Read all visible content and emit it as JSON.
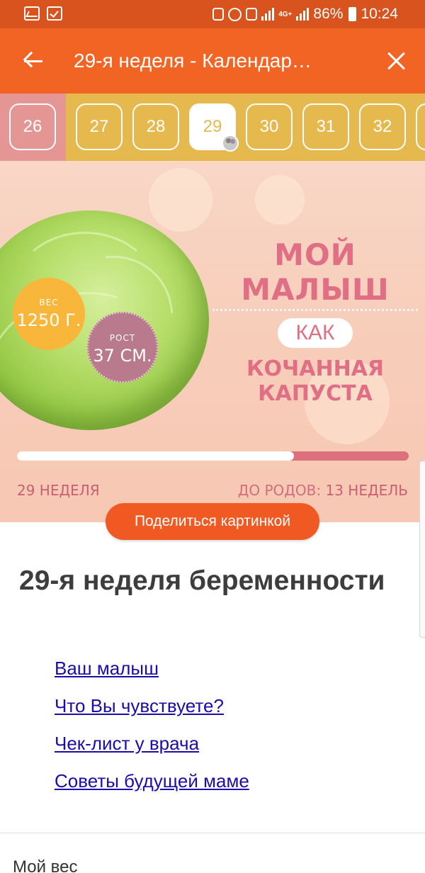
{
  "status_bar": {
    "network_type": "4G+",
    "battery_percent": "86%",
    "time": "10:24"
  },
  "app_bar": {
    "title": "29-я неделя - Календар…"
  },
  "weeks": {
    "past": "26",
    "current": "29",
    "items": [
      "26",
      "27",
      "28",
      "29",
      "30",
      "31",
      "32"
    ]
  },
  "banner": {
    "headline_top": "МОЙ МАЛЫШ",
    "headline_connector": "КАК",
    "headline_bottom": "КОЧАННАЯ КАПУСТА",
    "weight_label": "ВЕС",
    "weight_value": "1250 Г.",
    "height_label": "РОСТ",
    "height_value": "37 СМ.",
    "week_caption": "29 НЕДЕЛЯ",
    "remaining_label": "ДО РОДОВ:",
    "remaining_value": "13 НЕДЕЛЬ",
    "progress_fraction": 0.707
  },
  "share_button": "Поделиться картинкой",
  "article": {
    "title": "29-я неделя беременности",
    "toc": [
      "Ваш малыш",
      "Что Вы чувствуете?",
      "Чек-лист у врача",
      "Советы будущей маме"
    ]
  },
  "next_section": "Мой вес",
  "colors": {
    "status_bar": "#d9531e",
    "app_bar": "#f26424",
    "week_strip": "#e6b94f",
    "past_week": "#e49695",
    "accent_pink": "#e06f85",
    "share_button": "#f05a22",
    "link": "#1a0dab"
  }
}
